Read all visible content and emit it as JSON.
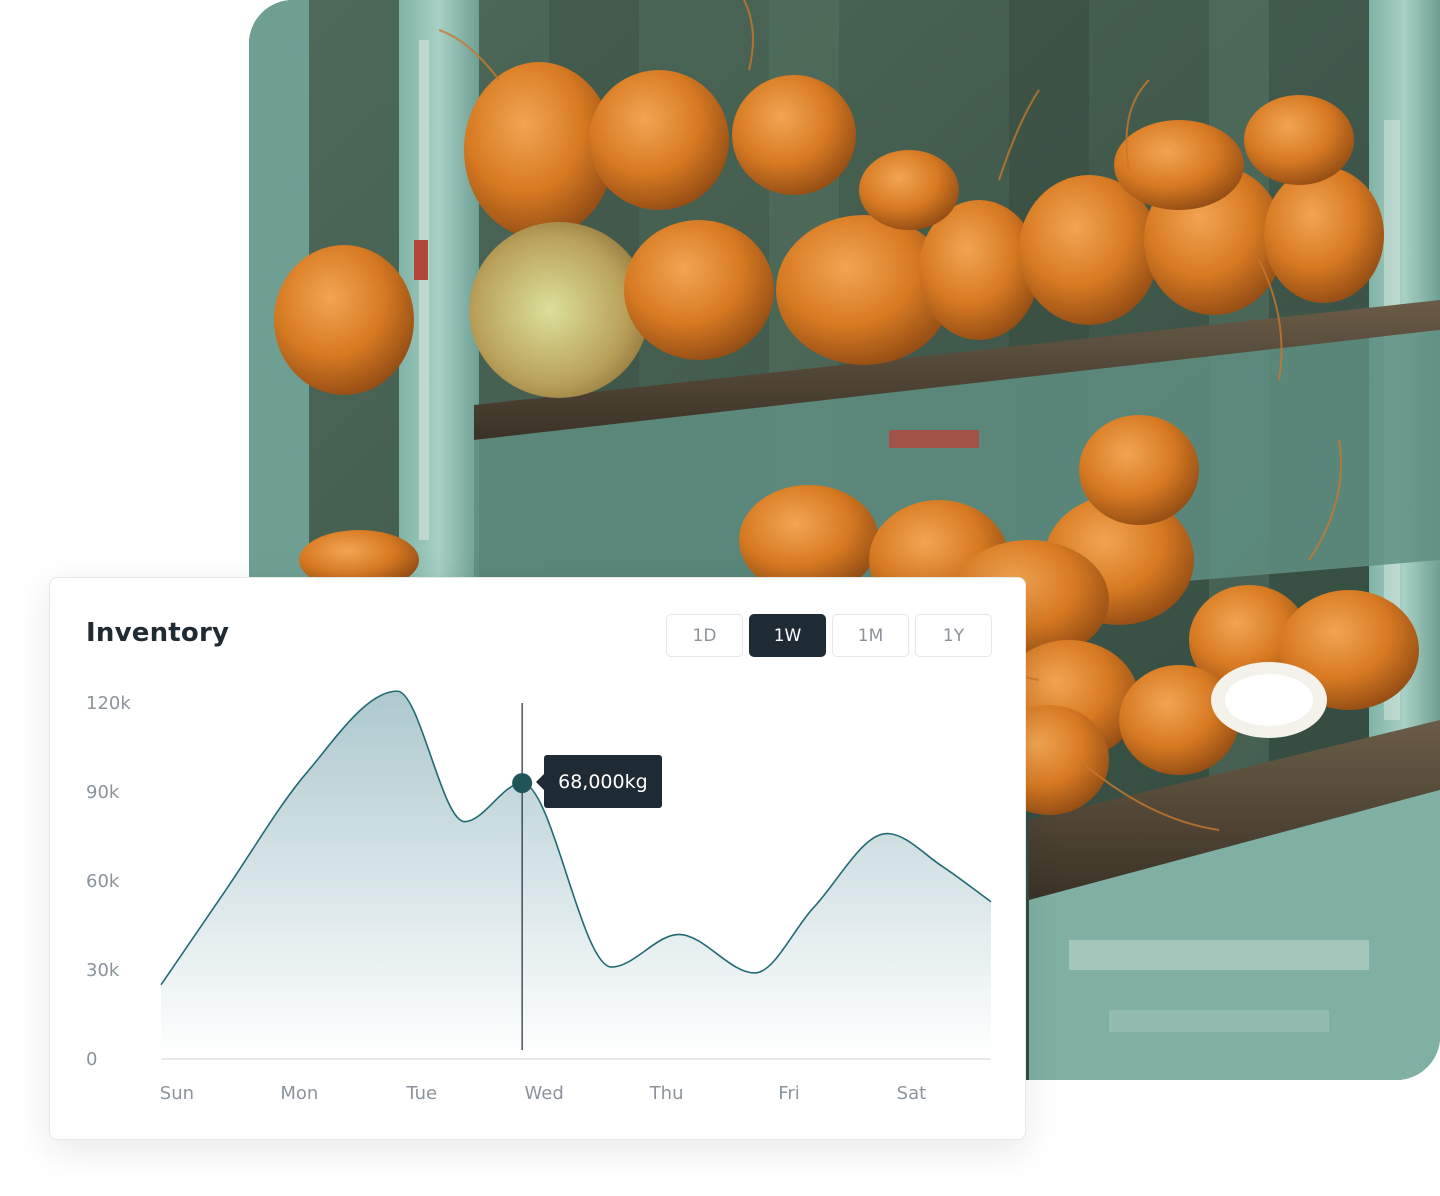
{
  "card": {
    "title": "Inventory"
  },
  "range_tabs": [
    {
      "label": "1D",
      "active": false
    },
    {
      "label": "1W",
      "active": true
    },
    {
      "label": "1M",
      "active": false
    },
    {
      "label": "1Y",
      "active": false
    }
  ],
  "tooltip": {
    "label": "68,000kg",
    "x": 2.82,
    "y": 93000
  },
  "colors": {
    "line": "#226a73",
    "area_top": "#9fbfc6",
    "marker": "#1f5559",
    "tooltip_bg": "#1f2b34"
  },
  "chart_data": {
    "type": "area",
    "title": "",
    "xlabel": "",
    "ylabel": "",
    "categories": [
      "Sun",
      "Mon",
      "Tue",
      "Wed",
      "Thu",
      "Fri",
      "Sat"
    ],
    "ylim": [
      0,
      120000
    ],
    "yticks": [
      {
        "value": 0,
        "label": "0"
      },
      {
        "value": 30000,
        "label": "30k"
      },
      {
        "value": 60000,
        "label": "60k"
      },
      {
        "value": 90000,
        "label": "90k"
      },
      {
        "value": 120000,
        "label": "120k"
      }
    ],
    "xlim": [
      -0.13,
      6.65
    ],
    "grid": false,
    "series": [
      {
        "x": [
          -0.13,
          0.4,
          1.05,
          1.8,
          2.35,
          2.82,
          3.55,
          4.1,
          4.72,
          5.2,
          5.8,
          6.25,
          6.65
        ],
        "y": [
          25000,
          57000,
          96000,
          124000,
          80000,
          93000,
          31000,
          42000,
          29000,
          51000,
          76000,
          65000,
          53000
        ]
      }
    ]
  }
}
